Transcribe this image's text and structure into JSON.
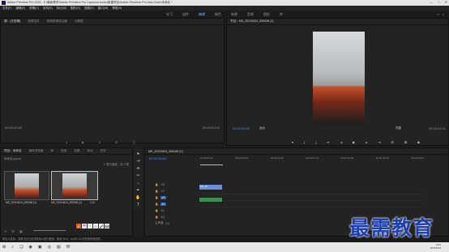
{
  "window": {
    "title": "Adobe Premiere Pro 2020 - E:\\最新教学\\Adobe Premiere Pro Captured Audio\\新建项目\\Adobe Premiere Pro Auto-Save\\未命名 *"
  },
  "menubar": [
    "文件(F)",
    "编辑(E)",
    "剪辑(C)",
    "序列(S)",
    "标记(M)",
    "图形(G)",
    "视图(V)",
    "窗口(W)",
    "帮助(H)"
  ],
  "workspaces": {
    "items": [
      "学习",
      "组件",
      "编辑",
      "颜色",
      "效果",
      "音频",
      "图形",
      "库"
    ],
    "active": "编辑"
  },
  "source_panel": {
    "tabs": [
      "源：(无剪辑)",
      "效果控件",
      "音频剪辑混合器",
      "元数据"
    ],
    "time_left": "00;00;00;00",
    "time_right": "00;00;00;00"
  },
  "program_panel": {
    "tab": "节目：MS_20210624_083048 (1)",
    "timecode": "00;00;00;00",
    "fit": "适合",
    "resolution": "完整",
    "duration": "00;00;01;01"
  },
  "project_panel": {
    "tabs": [
      "项目：未命名",
      "媒体浏览器",
      "库",
      "信息",
      "效果",
      "标记",
      "历史"
    ],
    "path": "未命名.prproj",
    "count": "1 项已选择，共 2 项",
    "clips": [
      {
        "name": "MS_20210624_083048 (1)",
        "duration": "1;01"
      },
      {
        "name": "MS_20210624_083048 (1)",
        "duration": "1;01"
      }
    ]
  },
  "timeline_panel": {
    "tab": "MS_20210624_083048 (1)",
    "timecode": "00;00;00;00",
    "ruler": [
      "00;00;00;00",
      "00;00;00;15",
      "00;00;01;00",
      "00;00;01;15",
      "00;00;02;00",
      "00;00;02;15",
      "00;00;03;00"
    ],
    "tracks": [
      "V3",
      "V2",
      "V1",
      "A1",
      "A2",
      "A3"
    ],
    "mix_label": "主声道",
    "mix_value": "0.0",
    "video_clip_label": "MS_20"
  },
  "status_bar": "单击以选择，或单击空白处并拖动以进行框选。使用 Shift、Alt 和 Ctrl 可获得其他选项。",
  "clock": {
    "time": "9:01",
    "date": "2021/6/24"
  },
  "watermark": "最需教育",
  "ime_logo": "S",
  "colors": {
    "accent": "#4a8bff",
    "work_area": "#d8c93a",
    "video_clip": "#6a8fd8",
    "audio_clip": "#3f8d52"
  }
}
